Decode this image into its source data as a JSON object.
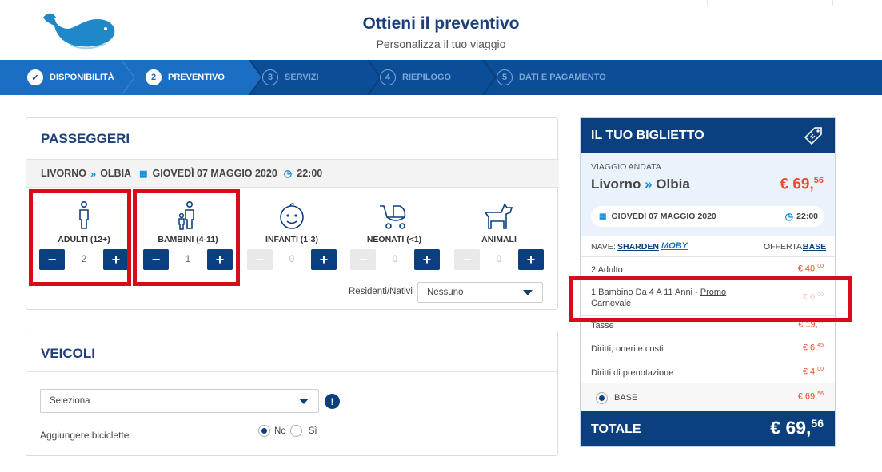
{
  "header": {
    "title": "Ottieni il preventivo",
    "subtitle": "Personalizza il tuo viaggio"
  },
  "steps": [
    {
      "num": "✓",
      "label": "DISPONIBILITÀ",
      "state": "done"
    },
    {
      "num": "2",
      "label": "PREVENTIVO",
      "state": "current"
    },
    {
      "num": "3",
      "label": "SERVIZI",
      "state": "inactive"
    },
    {
      "num": "4",
      "label": "RIEPILOGO",
      "state": "inactive"
    },
    {
      "num": "5",
      "label": "DATI E PAGAMENTO",
      "state": "inactive"
    }
  ],
  "passengers": {
    "title": "PASSEGGERI",
    "route": {
      "from": "LIVORNO",
      "to": "OLBIA",
      "date": "GIOVEDÌ 07 MAGGIO 2020",
      "time": "22:00"
    },
    "types": [
      {
        "label": "ADULTI (12+)",
        "count": "2",
        "icon": "adult-icon"
      },
      {
        "label": "BAMBINI (4-11)",
        "count": "1",
        "icon": "child-icon"
      },
      {
        "label": "INFANTI (1-3)",
        "count": "0",
        "icon": "infant-icon"
      },
      {
        "label": "NEONATI (<1)",
        "count": "0",
        "icon": "stroller-icon"
      },
      {
        "label": "ANIMALI",
        "count": "0",
        "icon": "dog-icon"
      }
    ],
    "residents_label": "Residenti/Nativi",
    "residents_value": "Nessuno"
  },
  "vehicles": {
    "title": "VEICOLI",
    "select_value": "Seleziona",
    "bicycles_label": "Aggiungere biciclette",
    "opt_no": "No",
    "opt_si": "Sì"
  },
  "ticket": {
    "title": "IL TUO BIGLIETTO",
    "trip_label": "VIAGGIO ANDATA",
    "from": "Livorno",
    "to": "Olbia",
    "price_main": "€ 69,",
    "price_cents": "56",
    "date": "GIOVEDÌ 07 MAGGIO 2020",
    "time": "22:00",
    "nave_label": "NAVE:",
    "nave_value": "SHARDEN",
    "company": "MOBY",
    "offerta_label": "OFFERTA:",
    "offerta_value": "BASE",
    "rows": [
      {
        "label": "2 Adulto",
        "price": "€ 40,",
        "cents": "00"
      },
      {
        "label": "1 Bambino Da 4 A 11 Anni - ",
        "link": "Promo Carnevale",
        "price": "€ 0,",
        "cents": "00"
      },
      {
        "label": "Tasse",
        "price": "€ 19,",
        "cents": "11"
      },
      {
        "label": "Diritti, oneri e costi",
        "price": "€ 6,",
        "cents": "45"
      },
      {
        "label": "Diritti di prenotazione",
        "price": "€ 4,",
        "cents": "00"
      },
      {
        "label": "BASE",
        "price": "€ 69,",
        "cents": "56"
      }
    ],
    "total_label": "TOTALE",
    "total_main": "€ 69,",
    "total_cents": "56"
  },
  "colors": {
    "brand": "#0b4e97",
    "dark": "#0b3f7e",
    "highlight": "#d80c18",
    "price": "#e94b2c"
  }
}
